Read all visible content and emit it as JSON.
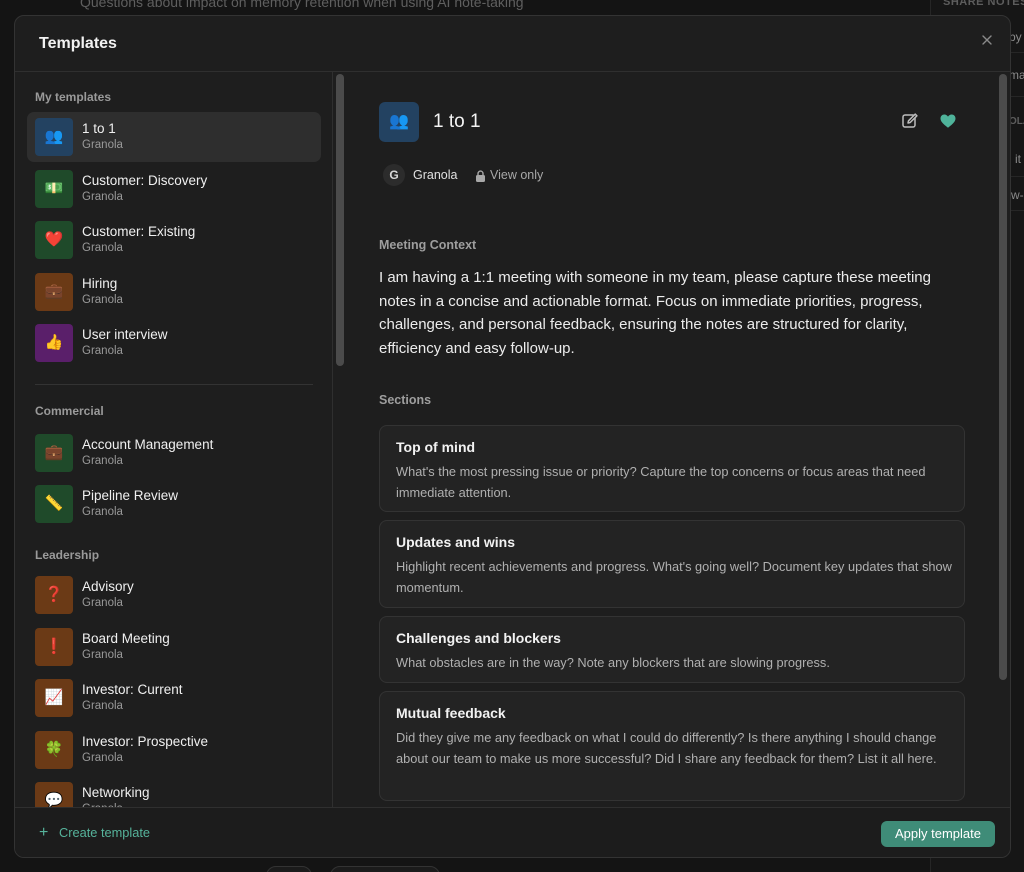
{
  "background": {
    "top_text": "Questions about impact on memory retention when using AI note-taking",
    "right_label": "SHARE NOTES",
    "right_texts": [
      "by",
      "ma",
      "OLA",
      "it",
      "w-"
    ]
  },
  "modal": {
    "title": "Templates",
    "close_icon": "close-icon"
  },
  "sidebar": {
    "groups": [
      {
        "label": "My templates",
        "items": [
          {
            "name": "1 to 1",
            "owner": "Granola",
            "emoji": "👥",
            "bg": "#234261",
            "active": true
          },
          {
            "name": "Customer: Discovery",
            "owner": "Granola",
            "emoji": "💵",
            "bg": "#1f4a2a"
          },
          {
            "name": "Customer: Existing",
            "owner": "Granola",
            "emoji": "❤️",
            "bg": "#1f4a2a"
          },
          {
            "name": "Hiring",
            "owner": "Granola",
            "emoji": "💼",
            "bg": "#6b3a16"
          },
          {
            "name": "User interview",
            "owner": "Granola",
            "emoji": "👍",
            "bg": "#5a1f6a"
          }
        ]
      },
      {
        "label": "Commercial",
        "items": [
          {
            "name": "Account Management",
            "owner": "Granola",
            "emoji": "💼",
            "bg": "#1f4a2a"
          },
          {
            "name": "Pipeline Review",
            "owner": "Granola",
            "emoji": "📏",
            "bg": "#1f4a2a"
          }
        ]
      },
      {
        "label": "Leadership",
        "items": [
          {
            "name": "Advisory",
            "owner": "Granola",
            "emoji": "❓",
            "bg": "#6b3a16"
          },
          {
            "name": "Board Meeting",
            "owner": "Granola",
            "emoji": "❗",
            "bg": "#6b3a16"
          },
          {
            "name": "Investor: Current",
            "owner": "Granola",
            "emoji": "📈",
            "bg": "#6b3a16"
          },
          {
            "name": "Investor: Prospective",
            "owner": "Granola",
            "emoji": "🍀",
            "bg": "#6b3a16"
          },
          {
            "name": "Networking",
            "owner": "Granola",
            "emoji": "💬",
            "bg": "#6b3a16"
          }
        ]
      }
    ]
  },
  "detail": {
    "emoji": "👥",
    "title": "1 to 1",
    "owner_initial": "G",
    "owner": "Granola",
    "access": "View only",
    "context_label": "Meeting Context",
    "context_text": "I am having a 1:1 meeting with someone in my team, please capture these meeting notes in a concise and actionable format. Focus on immediate priorities, progress, challenges, and personal feedback, ensuring the notes are structured for clarity, efficiency and easy follow-up.",
    "sections_label": "Sections",
    "sections": [
      {
        "title": "Top of mind",
        "desc": "What's the most pressing issue or priority? Capture the top concerns or focus areas that need immediate attention."
      },
      {
        "title": "Updates and wins",
        "desc": "Highlight recent achievements and progress. What's going well? Document key updates that show momentum."
      },
      {
        "title": "Challenges and blockers",
        "desc": "What obstacles are in the way? Note any blockers that are slowing progress."
      },
      {
        "title": "Mutual feedback",
        "desc": "Did they give me any feedback on what I could do differently? Is there anything I should change about our team to make us more successful? Did I share any feedback for them? List it all here."
      }
    ]
  },
  "footer": {
    "create_label": "Create template",
    "apply_label": "Apply template"
  },
  "colors": {
    "accent": "#56b39b",
    "apply_bg": "#3f8c78",
    "heart": "#4fb39a"
  }
}
